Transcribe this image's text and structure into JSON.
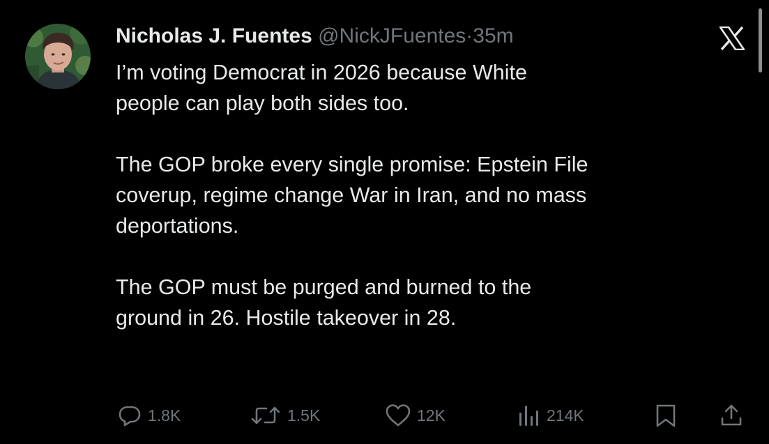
{
  "tweet": {
    "display_name": "Nicholas J. Fuentes",
    "handle": "@NickJFuentes",
    "separator": "·",
    "time": "35m",
    "paragraphs": [
      [
        "I’m voting Democrat in 2026 because White",
        "people can play both sides too."
      ],
      [
        "The GOP broke every single promise: Epstein File",
        "coverup, regime change War in Iran, and no mass",
        "deportations."
      ],
      [
        "The GOP must be purged and burned to the",
        "ground in 26. Hostile takeover in 28."
      ]
    ]
  },
  "actions": {
    "replies": "1.8K",
    "reposts": "1.5K",
    "likes": "12K",
    "views": "214K"
  },
  "icons": {
    "x_logo": "x-logo-icon",
    "reply": "reply-icon",
    "repost": "repost-icon",
    "like": "heart-icon",
    "views": "views-icon",
    "bookmark": "bookmark-icon",
    "share": "share-icon"
  },
  "colors": {
    "background": "#000000",
    "primary_text": "#e7e9ea",
    "secondary_text": "#71767b"
  }
}
